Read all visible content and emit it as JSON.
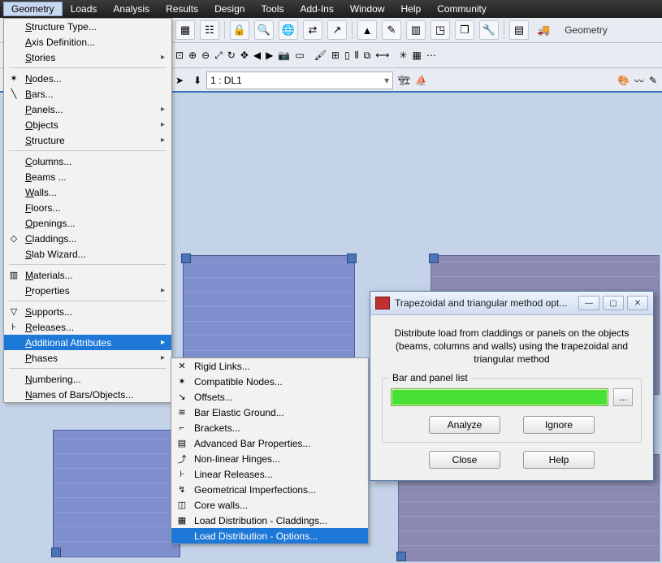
{
  "menubar": [
    "Geometry",
    "Loads",
    "Analysis",
    "Results",
    "Design",
    "Tools",
    "Add-Ins",
    "Window",
    "Help",
    "Community"
  ],
  "menubar_active": 0,
  "toolbar_geom_label": "Geometry",
  "load_combo": "1 : DL1",
  "geom_menu": {
    "items": [
      {
        "label": "Structure Type...",
        "icon": ""
      },
      {
        "label": "Axis Definition...",
        "icon": ""
      },
      {
        "label": "Stories",
        "icon": "",
        "sub": true
      },
      {
        "sep": true
      },
      {
        "label": "Nodes...",
        "icon": "✶"
      },
      {
        "label": "Bars...",
        "icon": "╲"
      },
      {
        "label": "Panels...",
        "icon": "",
        "sub": true
      },
      {
        "label": "Objects",
        "icon": "",
        "sub": true
      },
      {
        "label": "Structure",
        "icon": "",
        "sub": true
      },
      {
        "sep": true
      },
      {
        "label": "Columns...",
        "icon": ""
      },
      {
        "label": "Beams ...",
        "icon": ""
      },
      {
        "label": "Walls...",
        "icon": ""
      },
      {
        "label": "Floors...",
        "icon": ""
      },
      {
        "label": "Openings...",
        "icon": ""
      },
      {
        "label": "Claddings...",
        "icon": "◇"
      },
      {
        "label": "Slab Wizard...",
        "icon": ""
      },
      {
        "sep": true
      },
      {
        "label": "Materials...",
        "icon": "▥"
      },
      {
        "label": "Properties",
        "icon": "",
        "sub": true
      },
      {
        "sep": true
      },
      {
        "label": "Supports...",
        "icon": "▽"
      },
      {
        "label": "Releases...",
        "icon": "⊦"
      },
      {
        "label": "Additional Attributes",
        "icon": "",
        "sub": true,
        "hl": true
      },
      {
        "label": "Phases",
        "icon": "",
        "sub": true
      },
      {
        "sep": true
      },
      {
        "label": "Numbering...",
        "icon": ""
      },
      {
        "label": "Names of Bars/Objects...",
        "icon": ""
      }
    ]
  },
  "submenu": {
    "items": [
      {
        "label": "Rigid Links...",
        "icon": "✕"
      },
      {
        "label": "Compatible Nodes...",
        "icon": "✶"
      },
      {
        "label": "Offsets...",
        "icon": "↘"
      },
      {
        "label": "Bar Elastic Ground...",
        "icon": "≋"
      },
      {
        "label": "Brackets...",
        "icon": "⌐"
      },
      {
        "label": "Advanced Bar Properties...",
        "icon": "▤"
      },
      {
        "label": "Non-linear Hinges...",
        "icon": "⤴"
      },
      {
        "label": "Linear Releases...",
        "icon": "⊦"
      },
      {
        "label": "Geometrical Imperfections...",
        "icon": "↯"
      },
      {
        "label": "Core walls...",
        "icon": "◫"
      },
      {
        "label": "Load Distribution - Claddings...",
        "icon": "▦"
      },
      {
        "label": "Load Distribution - Options...",
        "icon": "",
        "hl": true
      }
    ]
  },
  "dialog": {
    "title": "Trapezoidal and triangular method opt...",
    "desc": "Distribute load from claddings or panels on the objects (beams, columns and walls) using the trapezoidal and triangular method",
    "group_label": "Bar and panel list",
    "input_value": "",
    "dots": "...",
    "analyze": "Analyze",
    "ignore": "Ignore",
    "close": "Close",
    "help": "Help"
  }
}
